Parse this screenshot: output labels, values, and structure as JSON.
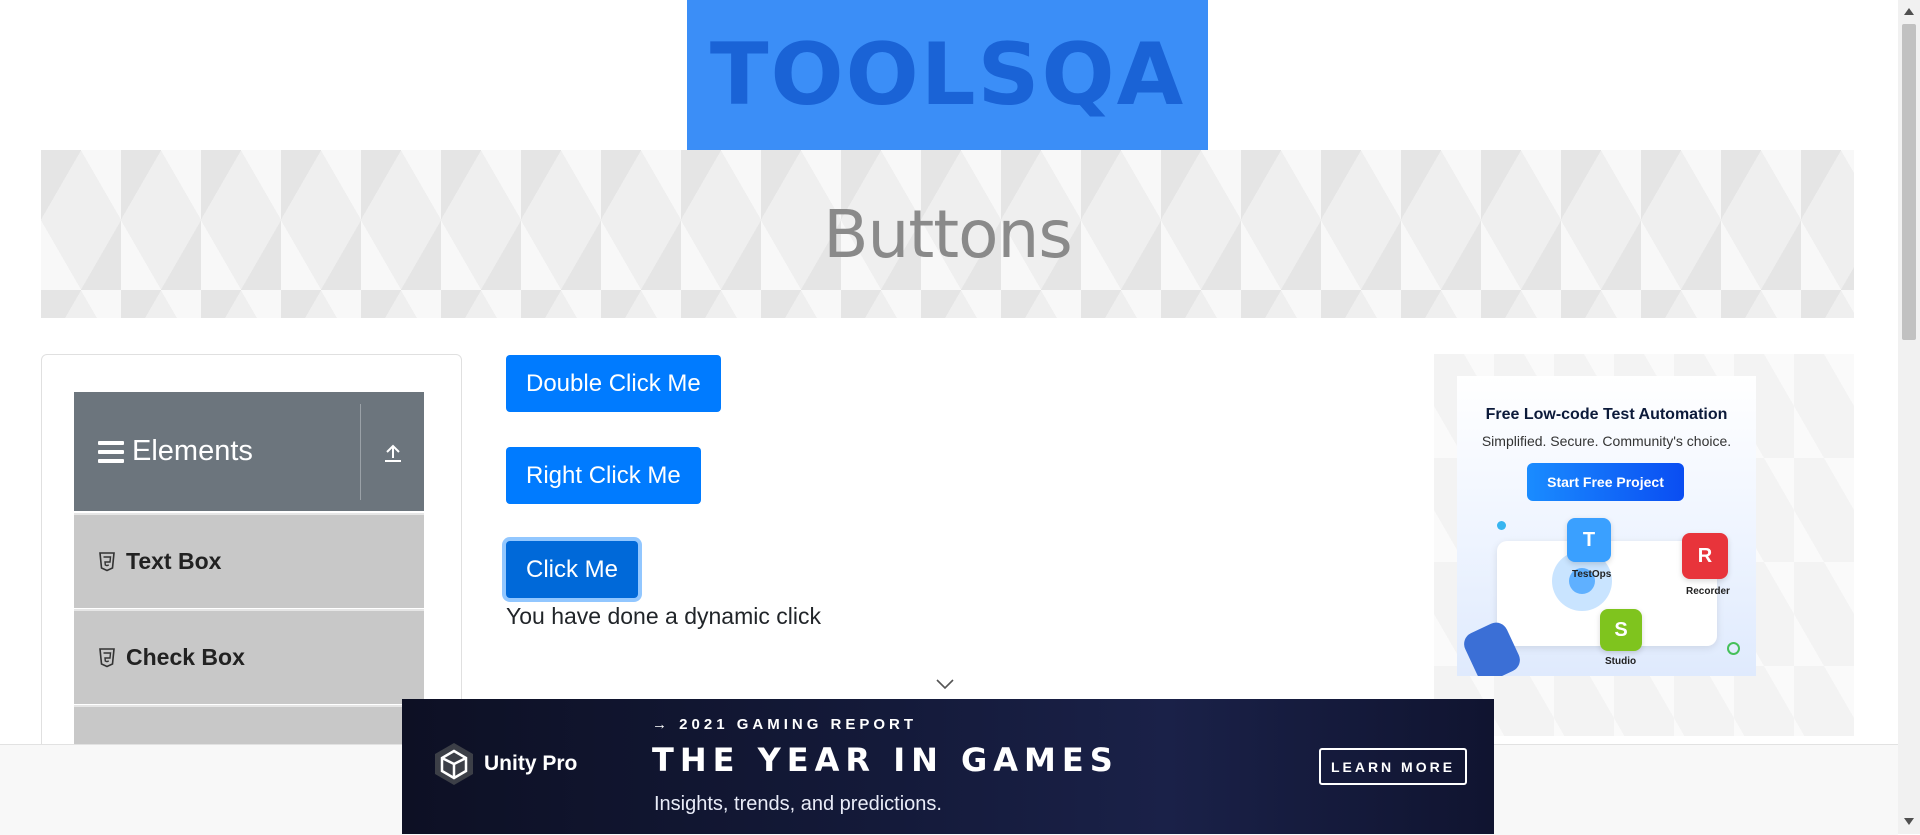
{
  "header": {
    "logo_text": "TOOLSQA"
  },
  "banner": {
    "title": "Buttons"
  },
  "sidebar": {
    "group_label": "Elements",
    "items": [
      {
        "label": "Text Box"
      },
      {
        "label": "Check Box"
      }
    ]
  },
  "buttons": {
    "double_click": "Double Click Me",
    "right_click": "Right Click Me",
    "click": "Click Me"
  },
  "result": {
    "dynamic_click_message": "You have done a dynamic click"
  },
  "right_ad": {
    "headline": "Free Low-code Test Automation",
    "subhead": "Simplified. Secure. Community's choice.",
    "cta": "Start Free Project",
    "products": [
      "TestOps",
      "Recorder",
      "Studio"
    ]
  },
  "bottom_ad": {
    "brand": "Unity Pro",
    "kicker": "→ 2021 GAMING REPORT",
    "headline": "THE YEAR IN GAMES",
    "subline": "Insights, trends, and predictions.",
    "cta": "LEARN MORE"
  },
  "colors": {
    "primary_button": "#007bff",
    "logo_bg": "#3b8ef7",
    "sidebar_header": "#6c757d",
    "sidebar_item": "#c8c8c8"
  }
}
